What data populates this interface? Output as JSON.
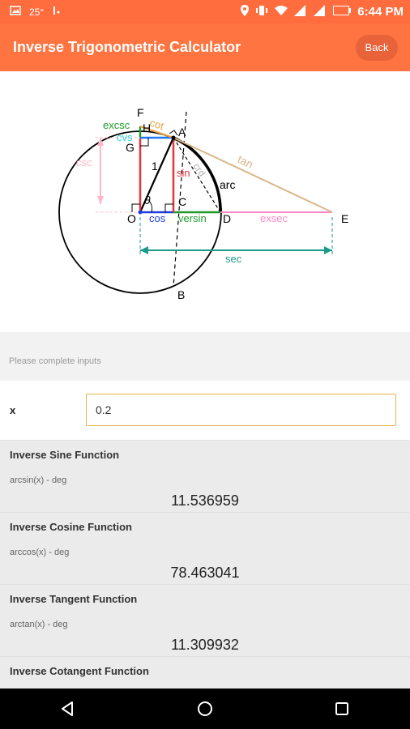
{
  "status_bar": {
    "temperature": "25°",
    "battery": "68",
    "time": "6:44 PM"
  },
  "app_bar": {
    "title": "Inverse Trigonometric Calculator",
    "back_label": "Back",
    "color": "#ff7440"
  },
  "diagram": {
    "labels": {
      "F": "F",
      "H": "H",
      "A": "A",
      "G": "G",
      "O": "O",
      "C": "C",
      "D": "D",
      "E": "E",
      "B": "B",
      "excsc": "excsc",
      "cot": "cot",
      "cvs": "cvs",
      "csc": "csc",
      "one": "1",
      "theta": "θ",
      "sin": "sin",
      "crd": "crd",
      "arc": "arc",
      "tan": "tan",
      "cos": "cos",
      "versin": "versin",
      "exsec": "exsec",
      "sec": "sec"
    }
  },
  "instruction": "Please complete inputs",
  "input": {
    "label": "x",
    "value": "0.2"
  },
  "results": [
    {
      "title": "Inverse Sine Function",
      "subtitle": "arcsin(x) - deg",
      "value": "11.536959"
    },
    {
      "title": "Inverse Cosine Function",
      "subtitle": "arccos(x) - deg",
      "value": "78.463041"
    },
    {
      "title": "Inverse Tangent Function",
      "subtitle": "arctan(x) - deg",
      "value": "11.309932"
    },
    {
      "title": "Inverse Cotangent Function",
      "subtitle": "",
      "value": ""
    }
  ]
}
